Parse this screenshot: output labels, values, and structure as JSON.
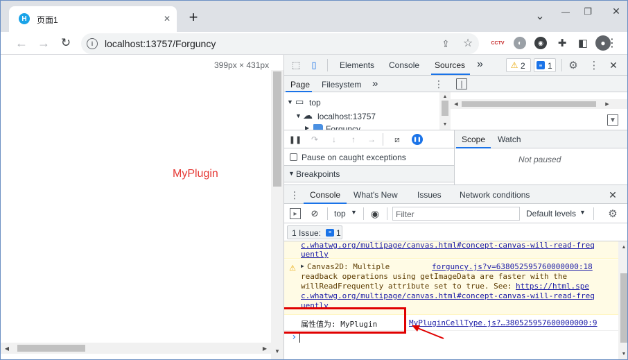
{
  "browser": {
    "tab_title": "页面1",
    "new_tab": "+",
    "url": "localhost:13757/Forguncy",
    "window_controls": {
      "minimize": "—",
      "restore": "❐",
      "close": "✕"
    },
    "caption_chevron": "⌄",
    "ext_badge": "CCTV"
  },
  "page": {
    "size_label": "399px × 431px",
    "plugin_text": "MyPlugin"
  },
  "devtools": {
    "main_tabs": [
      "Elements",
      "Console",
      "Sources"
    ],
    "more": "»",
    "warn_count": "2",
    "msg_count": "1",
    "nav_tabs": {
      "page": "Page",
      "filesystem": "Filesystem"
    },
    "tree": {
      "top": "top",
      "host": "localhost:13757",
      "folder": "Forguncy"
    },
    "pause_exceptions": "Pause on caught exceptions",
    "breakpoints": "Breakpoints",
    "scope_tabs": {
      "scope": "Scope",
      "watch": "Watch"
    },
    "not_paused": "Not paused",
    "drawer_tabs": [
      "Console",
      "What's New",
      "Issues",
      "Network conditions"
    ],
    "context": "top",
    "filter_placeholder": "Filter",
    "levels": "Default levels",
    "issues_label": "1 Issue:",
    "issues_count": "1",
    "console": {
      "line0": "c.whatwg.org/multipage/canvas.html#concept-canvas-will-read-freq",
      "line0b": "uently",
      "warn_prefix": "Canvas2D: Multiple",
      "warn_source": "forguncy.js?v=638052595760000000:18",
      "warn_l2": "readback operations using getImageData are faster with the",
      "warn_l3a": "willReadFrequently attribute set to true. See: ",
      "warn_l3b": "https://html.spe",
      "warn_l4": "c.whatwg.org/multipage/canvas.html#concept-canvas-will-read-freq",
      "warn_l5": "uently",
      "log_text": "属性值为: MyPlugin",
      "log_source": "MyPluginCellType.js?…380525957600000000:9",
      "prompt": "›"
    }
  },
  "colors": {
    "highlight": "#e00000",
    "plugin_text": "#e53935",
    "accent": "#1a73e8"
  }
}
